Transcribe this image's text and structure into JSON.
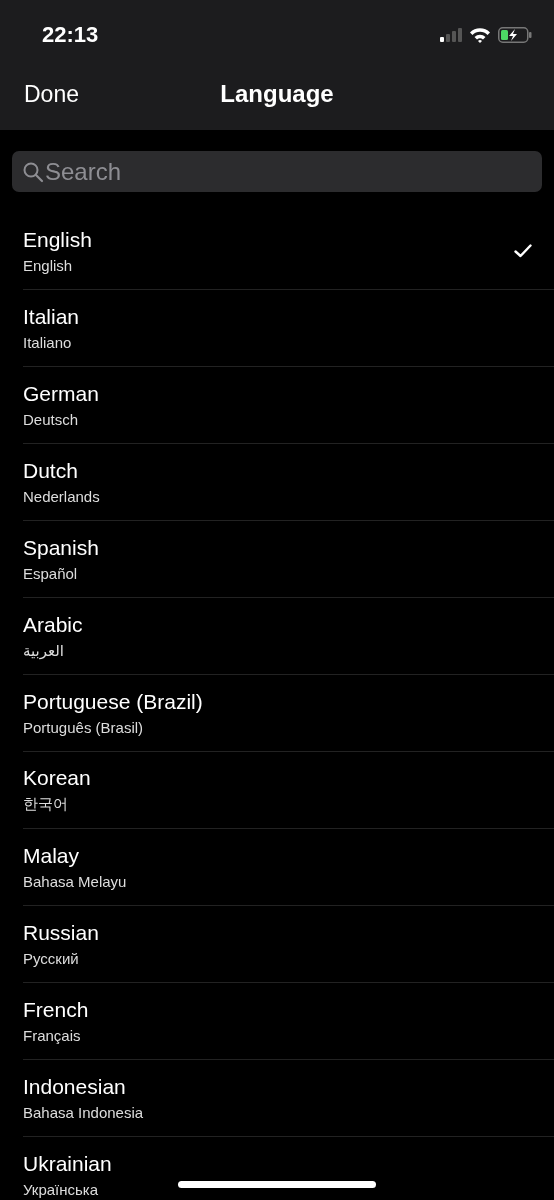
{
  "status_bar": {
    "time": "22:13"
  },
  "nav": {
    "done": "Done",
    "title": "Language"
  },
  "search": {
    "placeholder": "Search"
  },
  "languages": [
    {
      "name": "English",
      "native": "English",
      "selected": true
    },
    {
      "name": "Italian",
      "native": "Italiano",
      "selected": false
    },
    {
      "name": "German",
      "native": "Deutsch",
      "selected": false
    },
    {
      "name": "Dutch",
      "native": "Nederlands",
      "selected": false
    },
    {
      "name": "Spanish",
      "native": "Español",
      "selected": false
    },
    {
      "name": "Arabic",
      "native": "العربية",
      "selected": false
    },
    {
      "name": "Portuguese (Brazil)",
      "native": "Português (Brasil)",
      "selected": false
    },
    {
      "name": "Korean",
      "native": "한국어",
      "selected": false
    },
    {
      "name": "Malay",
      "native": "Bahasa Melayu",
      "selected": false
    },
    {
      "name": "Russian",
      "native": "Русский",
      "selected": false
    },
    {
      "name": "French",
      "native": "Français",
      "selected": false
    },
    {
      "name": "Indonesian",
      "native": "Bahasa Indonesia",
      "selected": false
    },
    {
      "name": "Ukrainian",
      "native": "Українська",
      "selected": false
    }
  ]
}
